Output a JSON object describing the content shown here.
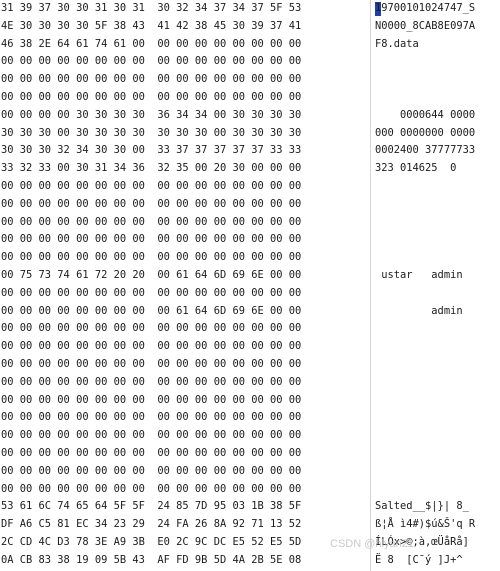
{
  "rows": [
    {
      "bytes": "31 39 37 30 30 31 30 31  30 32 34 37 34 37 5F 53",
      "ascii": "19700101024747_S"
    },
    {
      "bytes": "4E 30 30 30 30 5F 38 43  41 42 38 45 30 39 37 41",
      "ascii": "N0000_8CAB8E097A"
    },
    {
      "bytes": "46 38 2E 64 61 74 61 00  00 00 00 00 00 00 00 00",
      "ascii": "F8.data"
    },
    {
      "bytes": "00 00 00 00 00 00 00 00  00 00 00 00 00 00 00 00",
      "ascii": ""
    },
    {
      "bytes": "00 00 00 00 00 00 00 00  00 00 00 00 00 00 00 00",
      "ascii": ""
    },
    {
      "bytes": "00 00 00 00 00 00 00 00  00 00 00 00 00 00 00 00",
      "ascii": ""
    },
    {
      "bytes": "00 00 00 00 30 30 30 30  36 34 34 00 30 30 30 30",
      "ascii": "    0000644 0000"
    },
    {
      "bytes": "30 30 30 00 30 30 30 30  30 30 30 00 30 30 30 30",
      "ascii": "000 0000000 0000"
    },
    {
      "bytes": "30 30 30 32 34 30 30 00  33 37 37 37 37 37 33 33",
      "ascii": "0002400 37777733"
    },
    {
      "bytes": "33 32 33 00 30 31 34 36  32 35 00 20 30 00 00 00",
      "ascii": "323 014625  0"
    },
    {
      "bytes": "00 00 00 00 00 00 00 00  00 00 00 00 00 00 00 00",
      "ascii": ""
    },
    {
      "bytes": "00 00 00 00 00 00 00 00  00 00 00 00 00 00 00 00",
      "ascii": ""
    },
    {
      "bytes": "00 00 00 00 00 00 00 00  00 00 00 00 00 00 00 00",
      "ascii": ""
    },
    {
      "bytes": "00 00 00 00 00 00 00 00  00 00 00 00 00 00 00 00",
      "ascii": ""
    },
    {
      "bytes": "00 00 00 00 00 00 00 00  00 00 00 00 00 00 00 00",
      "ascii": ""
    },
    {
      "bytes": "00 75 73 74 61 72 20 20  00 61 64 6D 69 6E 00 00",
      "ascii": " ustar   admin"
    },
    {
      "bytes": "00 00 00 00 00 00 00 00  00 00 00 00 00 00 00 00",
      "ascii": ""
    },
    {
      "bytes": "00 00 00 00 00 00 00 00  00 61 64 6D 69 6E 00 00",
      "ascii": "         admin"
    },
    {
      "bytes": "00 00 00 00 00 00 00 00  00 00 00 00 00 00 00 00",
      "ascii": ""
    },
    {
      "bytes": "00 00 00 00 00 00 00 00  00 00 00 00 00 00 00 00",
      "ascii": ""
    },
    {
      "bytes": "00 00 00 00 00 00 00 00  00 00 00 00 00 00 00 00",
      "ascii": ""
    },
    {
      "bytes": "00 00 00 00 00 00 00 00  00 00 00 00 00 00 00 00",
      "ascii": ""
    },
    {
      "bytes": "00 00 00 00 00 00 00 00  00 00 00 00 00 00 00 00",
      "ascii": ""
    },
    {
      "bytes": "00 00 00 00 00 00 00 00  00 00 00 00 00 00 00 00",
      "ascii": ""
    },
    {
      "bytes": "00 00 00 00 00 00 00 00  00 00 00 00 00 00 00 00",
      "ascii": ""
    },
    {
      "bytes": "00 00 00 00 00 00 00 00  00 00 00 00 00 00 00 00",
      "ascii": ""
    },
    {
      "bytes": "00 00 00 00 00 00 00 00  00 00 00 00 00 00 00 00",
      "ascii": ""
    },
    {
      "bytes": "00 00 00 00 00 00 00 00  00 00 00 00 00 00 00 00",
      "ascii": ""
    },
    {
      "bytes": "53 61 6C 74 65 64 5F 5F  24 85 7D 95 03 1B 38 5F",
      "ascii": "Salted__$|}| 8_"
    },
    {
      "bytes": "DF A6 C5 81 EC 34 23 29  24 FA 26 8A 92 71 13 52",
      "ascii": "ß¦Å ì4#)$ú&Š'q R"
    },
    {
      "bytes": "2C CD 4C D3 78 3E A9 3B  E0 2C 9C DC E5 52 E5 5D",
      "ascii": "ÍLÓx>©;à,œÜåRå]"
    },
    {
      "bytes": "0A CB 83 38 19 09 5B 43  AF FD 9B 5D 4A 2B 5E 08",
      "ascii": "Ë 8  [C¯ý ]J+^"
    }
  ],
  "watermark_text": "CSDN @hlyan21"
}
